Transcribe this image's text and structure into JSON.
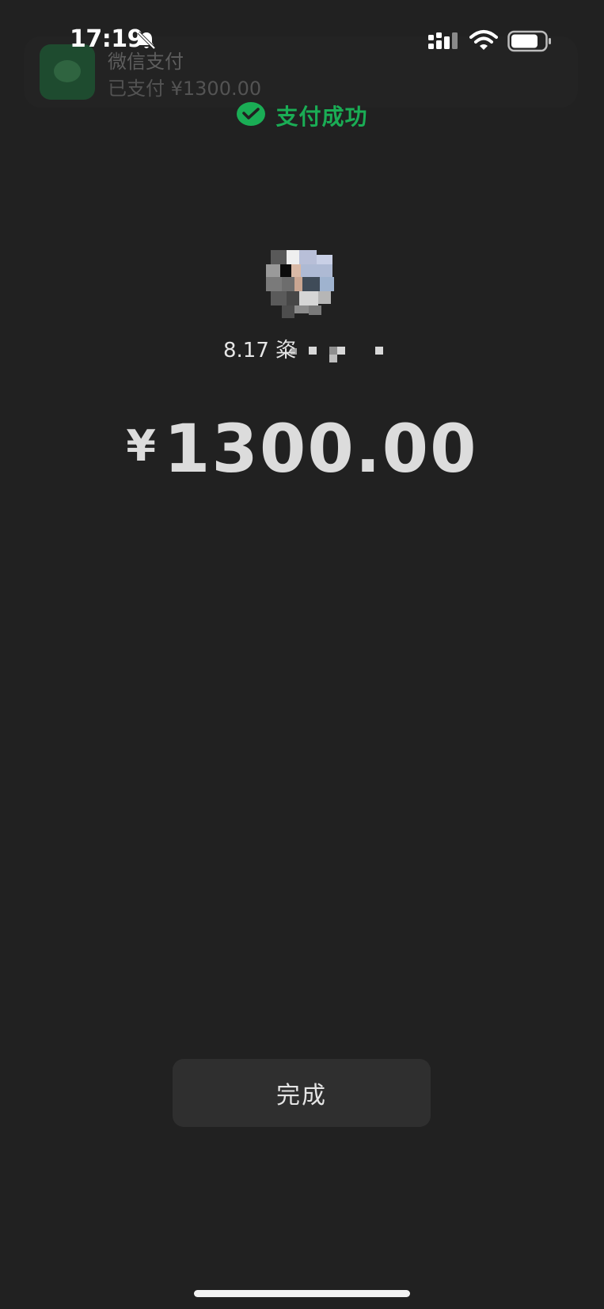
{
  "status_bar": {
    "time": "17:19",
    "icons": [
      "bell-off-icon",
      "signal-icon",
      "wifi-icon",
      "battery-icon"
    ]
  },
  "notification": {
    "app_icon": "wechat-pay-icon",
    "title": "微信支付",
    "body": "已支付 ¥1300.00"
  },
  "header": {
    "icon": "wechat-pay-icon",
    "status": "支付成功"
  },
  "merchant": {
    "name_visible": "8.17 粢"
  },
  "payment": {
    "currency_symbol": "¥",
    "amount": "1300.00"
  },
  "done_button": {
    "label": "完成"
  },
  "colors": {
    "background": "#212121",
    "success_green": "#1aad55",
    "button_bg": "#2f2f2f",
    "text": "#dcdcdc"
  }
}
